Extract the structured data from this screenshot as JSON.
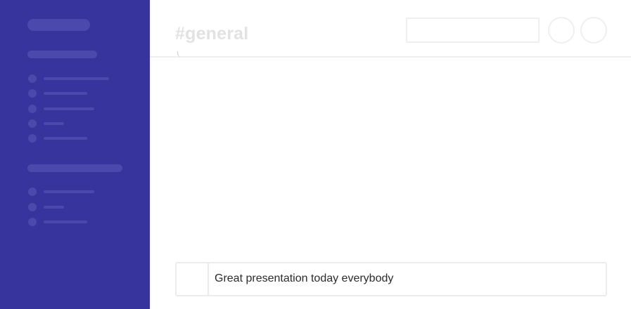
{
  "colors": {
    "sidebar_bg": "#38349d",
    "sidebar_skeleton": "#4c49ac",
    "header_border": "#f0f0f0",
    "title_text": "#e2e2e2",
    "message_text": "#2b2b2b"
  },
  "header": {
    "channel_title": "#general"
  },
  "messages": {
    "cutoff_glyph": "("
  },
  "composer": {
    "text": "Great presentation today everybody"
  }
}
